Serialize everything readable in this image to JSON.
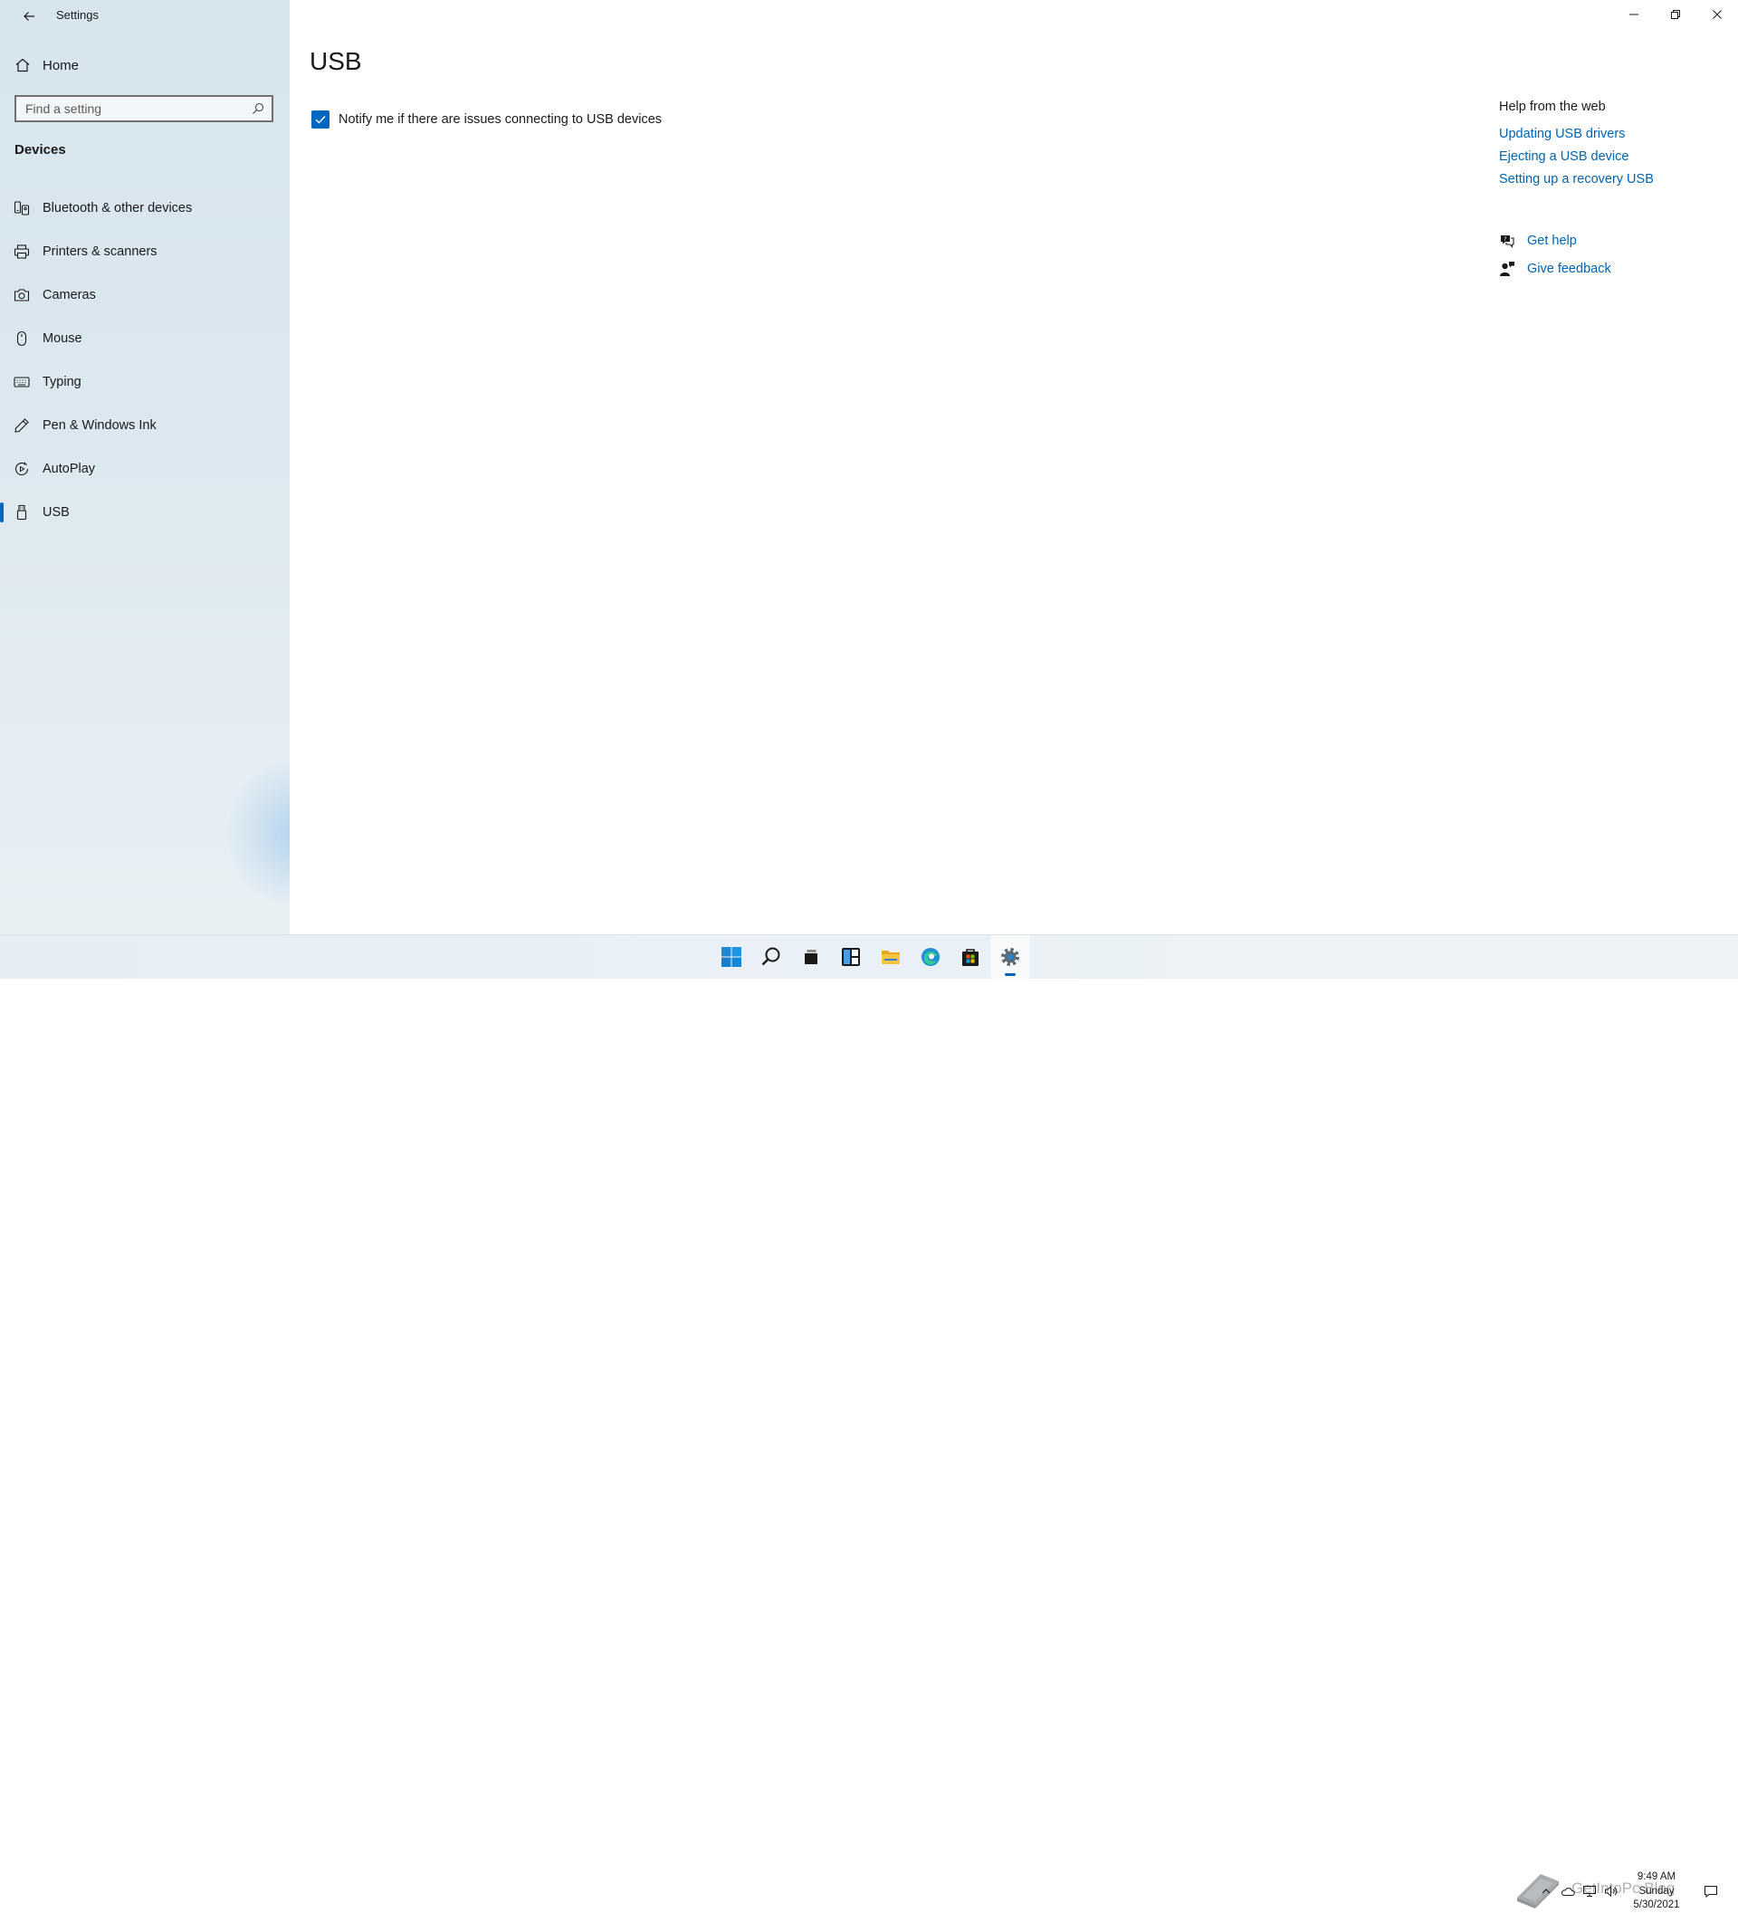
{
  "window": {
    "title": "Settings"
  },
  "sidebar": {
    "home_label": "Home",
    "search_placeholder": "Find a setting",
    "section_title": "Devices",
    "items": [
      {
        "label": "Bluetooth & other devices",
        "icon": "bluetooth-devices-icon"
      },
      {
        "label": "Printers & scanners",
        "icon": "printer-icon"
      },
      {
        "label": "Cameras",
        "icon": "camera-icon"
      },
      {
        "label": "Mouse",
        "icon": "mouse-icon"
      },
      {
        "label": "Typing",
        "icon": "keyboard-icon"
      },
      {
        "label": "Pen & Windows Ink",
        "icon": "pen-icon"
      },
      {
        "label": "AutoPlay",
        "icon": "autoplay-icon"
      },
      {
        "label": "USB",
        "icon": "usb-icon",
        "active": true
      }
    ]
  },
  "main": {
    "title": "USB",
    "notify_checkbox": {
      "label": "Notify me if there are issues connecting to USB devices",
      "checked": true
    }
  },
  "help": {
    "title": "Help from the web",
    "links": [
      "Updating USB drivers",
      "Ejecting a USB device",
      "Setting up a recovery USB"
    ],
    "get_help": "Get help",
    "give_feedback": "Give feedback"
  },
  "taskbar": {
    "apps": [
      "start",
      "search",
      "task-view",
      "widgets",
      "file-explorer",
      "edge",
      "store",
      "settings"
    ],
    "active_app": "settings",
    "watermark": "GetIntoPc Blog",
    "clock": {
      "time": "9:49 AM",
      "day": "Sunday",
      "date": "5/30/2021"
    }
  },
  "colors": {
    "accent": "#0067c0",
    "link": "#0063b1",
    "sidebar_bg": "#dce8ef"
  }
}
